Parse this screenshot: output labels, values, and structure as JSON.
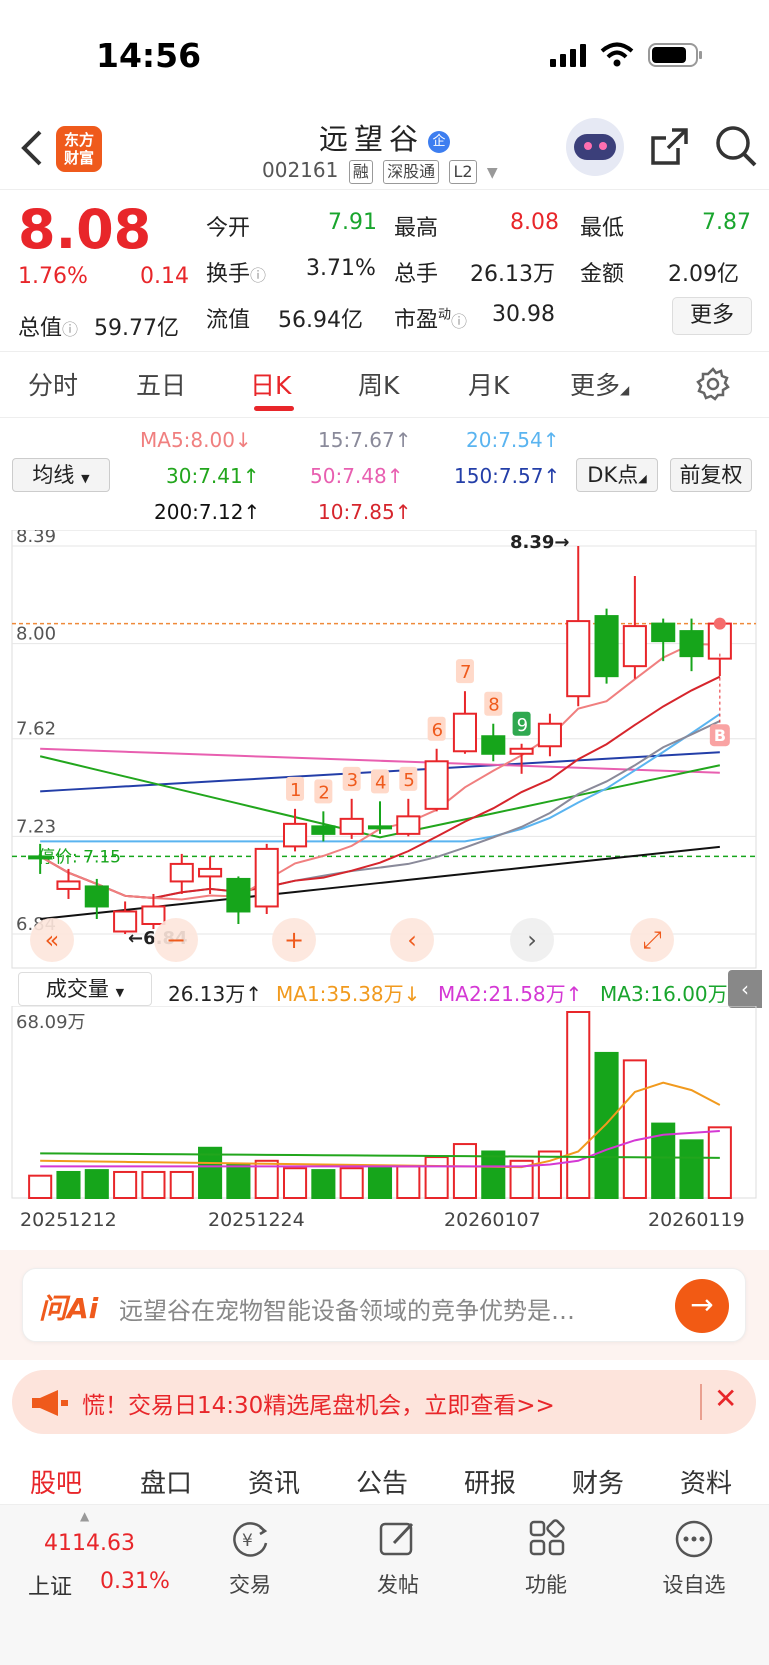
{
  "status": {
    "time": "14:56"
  },
  "header": {
    "logo_text": "东方\n财富",
    "stock_name": "远望谷",
    "badge": "企",
    "code": "002161",
    "tags": [
      "融",
      "深股通",
      "L2"
    ]
  },
  "quote": {
    "price": "8.08",
    "pct": "1.76%",
    "change": "0.14",
    "open_label": "今开",
    "open": "7.91",
    "high_label": "最高",
    "high": "8.08",
    "low_label": "最低",
    "low": "7.87",
    "turnover_label": "换手",
    "turnover": "3.71%",
    "volume_label": "总手",
    "volume": "26.13万",
    "amount_label": "金额",
    "amount": "2.09亿",
    "mcap_label": "总值",
    "mcap": "59.77亿",
    "float_label": "流值",
    "float": "56.94亿",
    "pe_label": "市盈",
    "pe_sup": "动",
    "pe": "30.98",
    "more_label": "更多"
  },
  "tabs": [
    "分时",
    "五日",
    "日K",
    "周K",
    "月K",
    "更多"
  ],
  "ma": {
    "ma5": "MA5:8.00↓",
    "ma15": "15:7.67↑",
    "ma20": "20:7.54↑",
    "ma30": "30:7.41↑",
    "ma50": "50:7.48↑",
    "ma150": "150:7.57↑",
    "ma200": "200:7.12↑",
    "ma10": "10:7.85↑",
    "select_label": "均线",
    "dk_label": "DK点",
    "fq_label": "前复权"
  },
  "kline": {
    "y_labels": [
      "8.39",
      "8.00",
      "7.62",
      "7.23",
      "6.84"
    ],
    "max_label": "8.39→",
    "min_label": "←6.84",
    "stop_label": "停价: 7.15",
    "b_marker": "B",
    "seq_labels": [
      "1",
      "2",
      "3",
      "4",
      "5",
      "6",
      "7",
      "8",
      "9"
    ],
    "colors": {
      "up": "#e8262a",
      "down": "#16a51b",
      "ma5": "#f07f7f",
      "ma10": "#d6252c",
      "ma15": "#8a8a9a",
      "ma20": "#5ab4f0",
      "ma30": "#22a61d",
      "ma50": "#e85fb0",
      "ma150": "#233ea8",
      "ma200": "#111111"
    }
  },
  "volume": {
    "select_label": "成交量",
    "current": "26.13万↑",
    "ma1": "MA1:35.38万↓",
    "ma2": "MA2:21.58万↑",
    "ma3": "MA3:16.00万",
    "y_top": "68.09万",
    "dates": [
      "20251212",
      "20251224",
      "20260107",
      "20260119"
    ]
  },
  "chart_data": {
    "type": "candlestick",
    "ylim": [
      6.84,
      8.39
    ],
    "candles": [
      {
        "o": 7.15,
        "c": 7.15,
        "h": 7.2,
        "l": 7.08,
        "up": false
      },
      {
        "o": 7.05,
        "c": 7.02,
        "h": 7.1,
        "l": 6.98,
        "up": true
      },
      {
        "o": 7.03,
        "c": 6.95,
        "h": 7.06,
        "l": 6.9,
        "up": false
      },
      {
        "o": 6.93,
        "c": 6.85,
        "h": 6.97,
        "l": 6.84,
        "up": true
      },
      {
        "o": 6.88,
        "c": 6.95,
        "h": 7.0,
        "l": 6.86,
        "up": true
      },
      {
        "o": 7.05,
        "c": 7.12,
        "h": 7.16,
        "l": 7.0,
        "up": true
      },
      {
        "o": 7.07,
        "c": 7.1,
        "h": 7.15,
        "l": 7.0,
        "up": true
      },
      {
        "o": 7.06,
        "c": 6.93,
        "h": 7.07,
        "l": 6.88,
        "up": false
      },
      {
        "o": 6.95,
        "c": 7.18,
        "h": 7.2,
        "l": 6.92,
        "up": true
      },
      {
        "o": 7.19,
        "c": 7.28,
        "h": 7.34,
        "l": 7.17,
        "up": true
      },
      {
        "o": 7.24,
        "c": 7.27,
        "h": 7.33,
        "l": 7.21,
        "up": false
      },
      {
        "o": 7.24,
        "c": 7.3,
        "h": 7.38,
        "l": 7.22,
        "up": true
      },
      {
        "o": 7.27,
        "c": 7.27,
        "h": 7.37,
        "l": 7.24,
        "up": false
      },
      {
        "o": 7.24,
        "c": 7.31,
        "h": 7.38,
        "l": 7.23,
        "up": true
      },
      {
        "o": 7.34,
        "c": 7.53,
        "h": 7.58,
        "l": 7.33,
        "up": true
      },
      {
        "o": 7.57,
        "c": 7.72,
        "h": 7.81,
        "l": 7.56,
        "up": true
      },
      {
        "o": 7.56,
        "c": 7.63,
        "h": 7.68,
        "l": 7.53,
        "up": false
      },
      {
        "o": 7.56,
        "c": 7.58,
        "h": 7.6,
        "l": 7.48,
        "up": true
      },
      {
        "o": 7.59,
        "c": 7.68,
        "h": 7.72,
        "l": 7.55,
        "up": true
      },
      {
        "o": 7.79,
        "c": 8.09,
        "h": 8.39,
        "l": 7.75,
        "up": true
      },
      {
        "o": 8.11,
        "c": 7.87,
        "h": 8.14,
        "l": 7.84,
        "up": false
      },
      {
        "o": 7.91,
        "c": 8.07,
        "h": 8.27,
        "l": 7.86,
        "up": true
      },
      {
        "o": 8.08,
        "c": 8.01,
        "h": 8.1,
        "l": 7.93,
        "up": false
      },
      {
        "o": 8.05,
        "c": 7.95,
        "h": 8.1,
        "l": 7.89,
        "up": false
      },
      {
        "o": 7.94,
        "c": 8.08,
        "h": 8.08,
        "l": 7.87,
        "up": true
      }
    ],
    "volumes": [
      {
        "v": 0.12,
        "up": true
      },
      {
        "v": 0.14,
        "up": false
      },
      {
        "v": 0.15,
        "up": false
      },
      {
        "v": 0.14,
        "up": true
      },
      {
        "v": 0.14,
        "up": true
      },
      {
        "v": 0.14,
        "up": true
      },
      {
        "v": 0.27,
        "up": false
      },
      {
        "v": 0.18,
        "up": false
      },
      {
        "v": 0.2,
        "up": true
      },
      {
        "v": 0.16,
        "up": true
      },
      {
        "v": 0.15,
        "up": false
      },
      {
        "v": 0.16,
        "up": true
      },
      {
        "v": 0.17,
        "up": false
      },
      {
        "v": 0.17,
        "up": true
      },
      {
        "v": 0.22,
        "up": true
      },
      {
        "v": 0.29,
        "up": true
      },
      {
        "v": 0.25,
        "up": false
      },
      {
        "v": 0.2,
        "up": true
      },
      {
        "v": 0.25,
        "up": true
      },
      {
        "v": 1.0,
        "up": true
      },
      {
        "v": 0.78,
        "up": false
      },
      {
        "v": 0.74,
        "up": true
      },
      {
        "v": 0.4,
        "up": false
      },
      {
        "v": 0.31,
        "up": false
      },
      {
        "v": 0.38,
        "up": true
      }
    ]
  },
  "ai": {
    "label": "问Ai",
    "placeholder": "远望谷在宠物智能设备领域的竞争优势是…"
  },
  "banner": {
    "text": "慌！交易日14:30精选尾盘机会，立即查看>>"
  },
  "subtabs": [
    "股吧",
    "盘口",
    "资讯",
    "公告",
    "研报",
    "财务",
    "资料"
  ],
  "bottom": {
    "index_value": "4114.63",
    "index_name": "上证",
    "index_pct": "0.31%",
    "nav": [
      "交易",
      "发帖",
      "功能",
      "设自选"
    ]
  }
}
